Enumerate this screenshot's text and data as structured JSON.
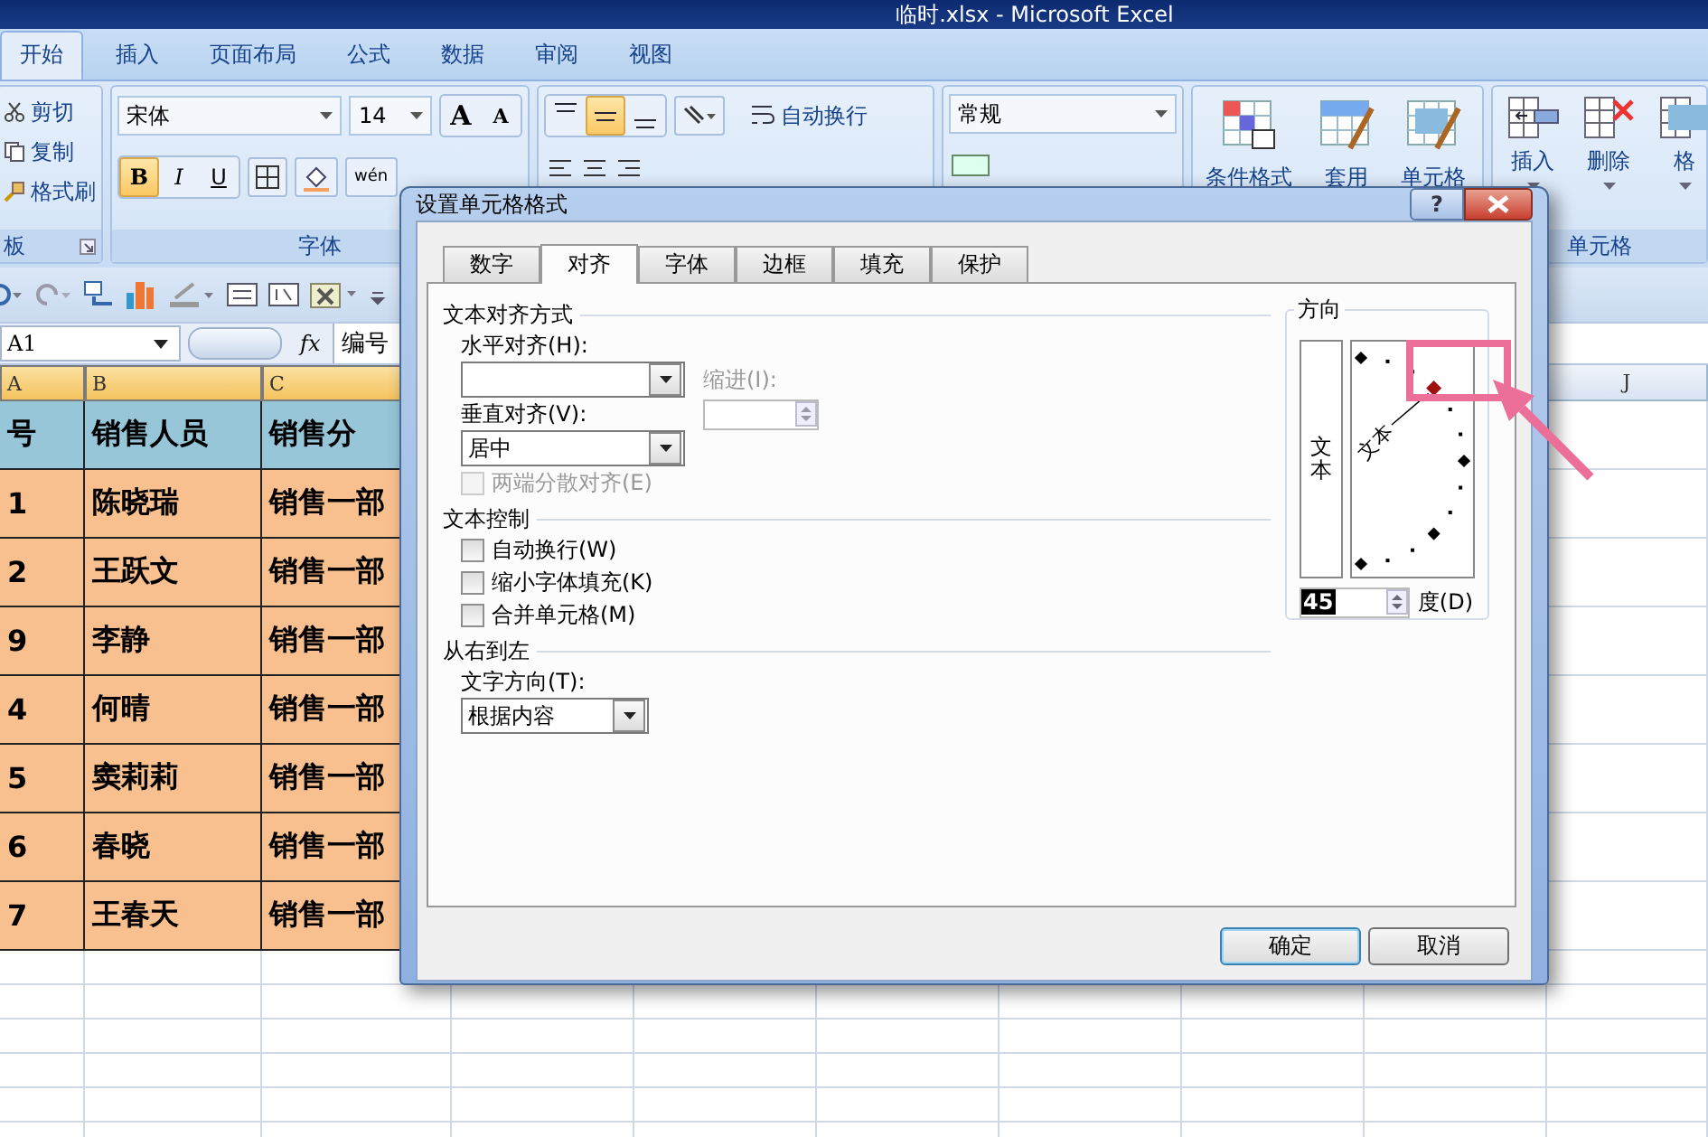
{
  "window": {
    "title": "临时.xlsx - Microsoft Excel"
  },
  "ribbon_tabs": [
    {
      "label": "开始",
      "selected": true
    },
    {
      "label": "插入",
      "selected": false
    },
    {
      "label": "页面布局",
      "selected": false
    },
    {
      "label": "公式",
      "selected": false
    },
    {
      "label": "数据",
      "selected": false
    },
    {
      "label": "审阅",
      "selected": false
    },
    {
      "label": "视图",
      "selected": false
    }
  ],
  "clipboard": {
    "items": [
      {
        "kind": "cut",
        "label": "剪切"
      },
      {
        "kind": "copy",
        "label": "复制"
      },
      {
        "kind": "painter",
        "label": "格式刷"
      }
    ],
    "group_label": "板"
  },
  "font": {
    "name": "宋体",
    "size": "14",
    "grow": "A",
    "shrink": "A",
    "styles": [
      {
        "label": "B",
        "selected": true
      },
      {
        "label": "I",
        "selected": false
      },
      {
        "label": "U",
        "selected": false
      }
    ],
    "phonetic": "wén",
    "group_label": "字体"
  },
  "alignment": {
    "vertical": [
      {
        "kind": "top",
        "selected": false
      },
      {
        "kind": "middle",
        "selected": true
      },
      {
        "kind": "bottom",
        "selected": false
      }
    ],
    "wrap_label": "自动换行"
  },
  "number": {
    "format": "常规"
  },
  "styles": [
    {
      "kind": "conditional",
      "label": "条件格式"
    },
    {
      "kind": "table",
      "label": "套用"
    },
    {
      "kind": "cell",
      "label": "单元格"
    }
  ],
  "cells": {
    "buttons": [
      {
        "kind": "insert",
        "label": "插入"
      },
      {
        "kind": "delete",
        "label": "删除"
      },
      {
        "kind": "format",
        "label": "格"
      }
    ],
    "group_label": "单元格"
  },
  "formula_bar": {
    "name_box": "A1",
    "fx": "fx",
    "formula": "编号"
  },
  "columns": [
    {
      "label": "A",
      "selected": true
    },
    {
      "label": "B",
      "selected": true
    },
    {
      "label": "C",
      "selected": true
    },
    {
      "label": "J",
      "selected": false
    }
  ],
  "rows": [
    {
      "kind": "header",
      "cells": [
        "号",
        "销售人员",
        "销售分"
      ]
    },
    {
      "kind": "data",
      "cells": [
        "1",
        "陈晓瑞",
        "销售一部"
      ]
    },
    {
      "kind": "data",
      "cells": [
        "2",
        "王跃文",
        "销售一部"
      ]
    },
    {
      "kind": "data",
      "cells": [
        "9",
        "李静",
        "销售一部"
      ]
    },
    {
      "kind": "data",
      "cells": [
        "4",
        "何晴",
        "销售一部"
      ]
    },
    {
      "kind": "data",
      "cells": [
        "5",
        "窦莉莉",
        "销售一部"
      ]
    },
    {
      "kind": "data",
      "cells": [
        "6",
        "春晓",
        "销售一部"
      ]
    },
    {
      "kind": "data",
      "cells": [
        "7",
        "王春天",
        "销售一部"
      ]
    }
  ],
  "dialog": {
    "title": "设置单元格格式",
    "help": "?",
    "tabs": [
      {
        "label": "数字",
        "selected": false
      },
      {
        "label": "对齐",
        "selected": true
      },
      {
        "label": "字体",
        "selected": false
      },
      {
        "label": "边框",
        "selected": false
      },
      {
        "label": "填充",
        "selected": false
      },
      {
        "label": "保护",
        "selected": false
      }
    ],
    "text_alignment": {
      "heading": "文本对齐方式",
      "horizontal_label": "水平对齐(H):",
      "indent_label": "缩进(I):",
      "vertical_label": "垂直对齐(V):",
      "vertical_value": "居中",
      "distributed": {
        "label": "两端分散对齐(E)",
        "checked": false,
        "disabled": true
      }
    },
    "text_control": {
      "heading": "文本控制",
      "options": [
        {
          "label": "自动换行(W)",
          "checked": false
        },
        {
          "label": "缩小字体填充(K)",
          "checked": false
        },
        {
          "label": "合并单元格(M)",
          "checked": false
        }
      ]
    },
    "right_to_left": {
      "heading": "从右到左",
      "direction_label": "文字方向(T):",
      "direction_value": "根据内容"
    },
    "orientation": {
      "heading": "方向",
      "vertical_text": "文本",
      "dial_text": "文本",
      "degrees": "45",
      "degrees_label": "度(D)"
    },
    "buttons": [
      {
        "label": "确定",
        "default": true
      },
      {
        "label": "取消",
        "default": false
      }
    ]
  }
}
